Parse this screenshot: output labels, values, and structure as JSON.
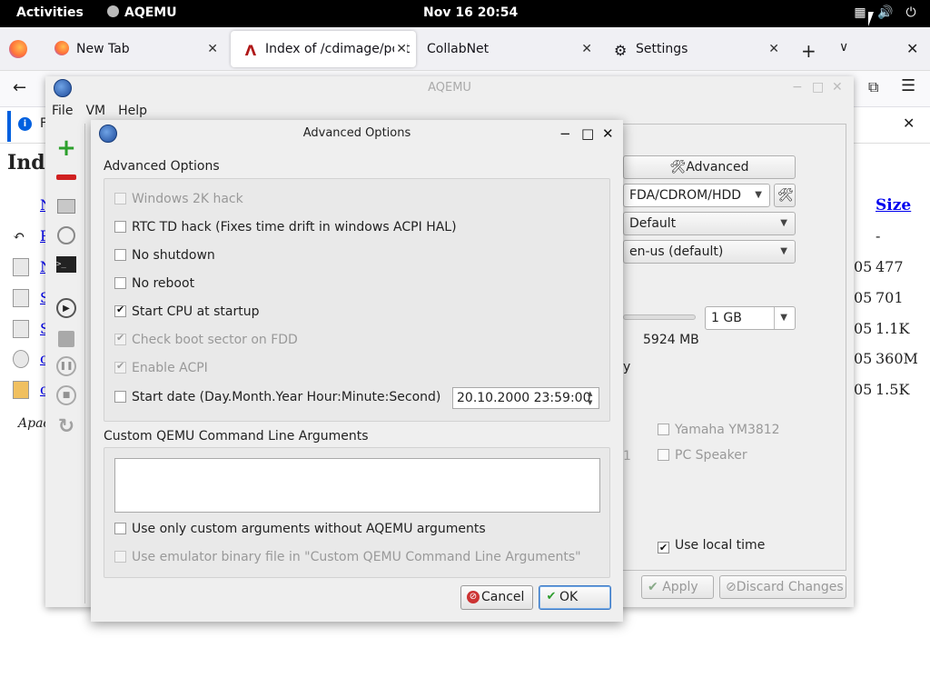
{
  "topbar": {
    "activities": "Activities",
    "app_name": "AQEMU",
    "clock": "Nov 16  20:54"
  },
  "browser": {
    "tabs": [
      {
        "label": "New Tab",
        "close": "✕"
      },
      {
        "label": "Index of /cdimage/port",
        "close": "✕"
      },
      {
        "label": "CollabNet",
        "close": "✕"
      },
      {
        "label": "Settings",
        "close": "✕"
      }
    ],
    "newtab": "+",
    "list_tabs": "∨",
    "close_window": "✕",
    "back": "←",
    "menu": "☰",
    "extensions": "⧉",
    "infobar_text": "F",
    "infobar_close": "✕"
  },
  "page": {
    "heading": "Inde",
    "size_header": "Size",
    "rows": [
      {
        "name": "N",
        "year": "",
        "size": ""
      },
      {
        "name": "P",
        "year": "",
        "size": "-"
      },
      {
        "name": "N",
        "year": "05",
        "size": "477"
      },
      {
        "name": "S",
        "year": "05",
        "size": "701"
      },
      {
        "name": "S",
        "year": "05",
        "size": "1.1K"
      },
      {
        "name": "c",
        "year": "05",
        "size": "360M"
      },
      {
        "name": "c",
        "year": "05",
        "size": "1.5K"
      }
    ],
    "signature": "Apac"
  },
  "aqemu": {
    "title": "AQEMU",
    "menu": {
      "file": "File",
      "vm": "VM",
      "help": "Help"
    },
    "right": {
      "advanced": "Advanced",
      "boot_device": "FDA/CDROM/HDD",
      "combo2": "Default",
      "keyboard": "en-us (default)",
      "memory": "1 GB",
      "free_mem": "5924 MB",
      "y_label": "y",
      "one_label": "1",
      "yamaha": "Yamaha YM3812",
      "pc_speaker": "PC Speaker",
      "use_local_time": "Use local time",
      "apply": "Apply",
      "discard": "Discard Changes"
    }
  },
  "dialog": {
    "title": "Advanced Options",
    "group1_title": "Advanced Options",
    "options": [
      {
        "label": "Windows 2K hack",
        "checked": false,
        "disabled": true
      },
      {
        "label": "RTC TD hack (Fixes time drift in windows ACPI HAL)",
        "checked": false,
        "disabled": false
      },
      {
        "label": "No shutdown",
        "checked": false,
        "disabled": false
      },
      {
        "label": "No reboot",
        "checked": false,
        "disabled": false
      },
      {
        "label": "Start CPU at startup",
        "checked": true,
        "disabled": false
      },
      {
        "label": "Check boot sector on FDD",
        "checked": true,
        "disabled": true
      },
      {
        "label": "Enable ACPI",
        "checked": true,
        "disabled": true
      },
      {
        "label": "Start date (Day.Month.Year Hour:Minute:Second)",
        "checked": false,
        "disabled": false
      }
    ],
    "start_date_value": "20.10.2000 23:59:00",
    "group2_title": "Custom QEMU Command Line Arguments",
    "custom_args_value": "",
    "use_only_custom": "Use only custom arguments without AQEMU arguments",
    "use_emulator_binary": "Use emulator binary file in \"Custom QEMU Command Line Arguments\"",
    "cancel": "Cancel",
    "ok": "OK"
  },
  "colors": {
    "topbar_bg": "#000000",
    "accent": "#3b78c4",
    "link": "#0000ee"
  }
}
